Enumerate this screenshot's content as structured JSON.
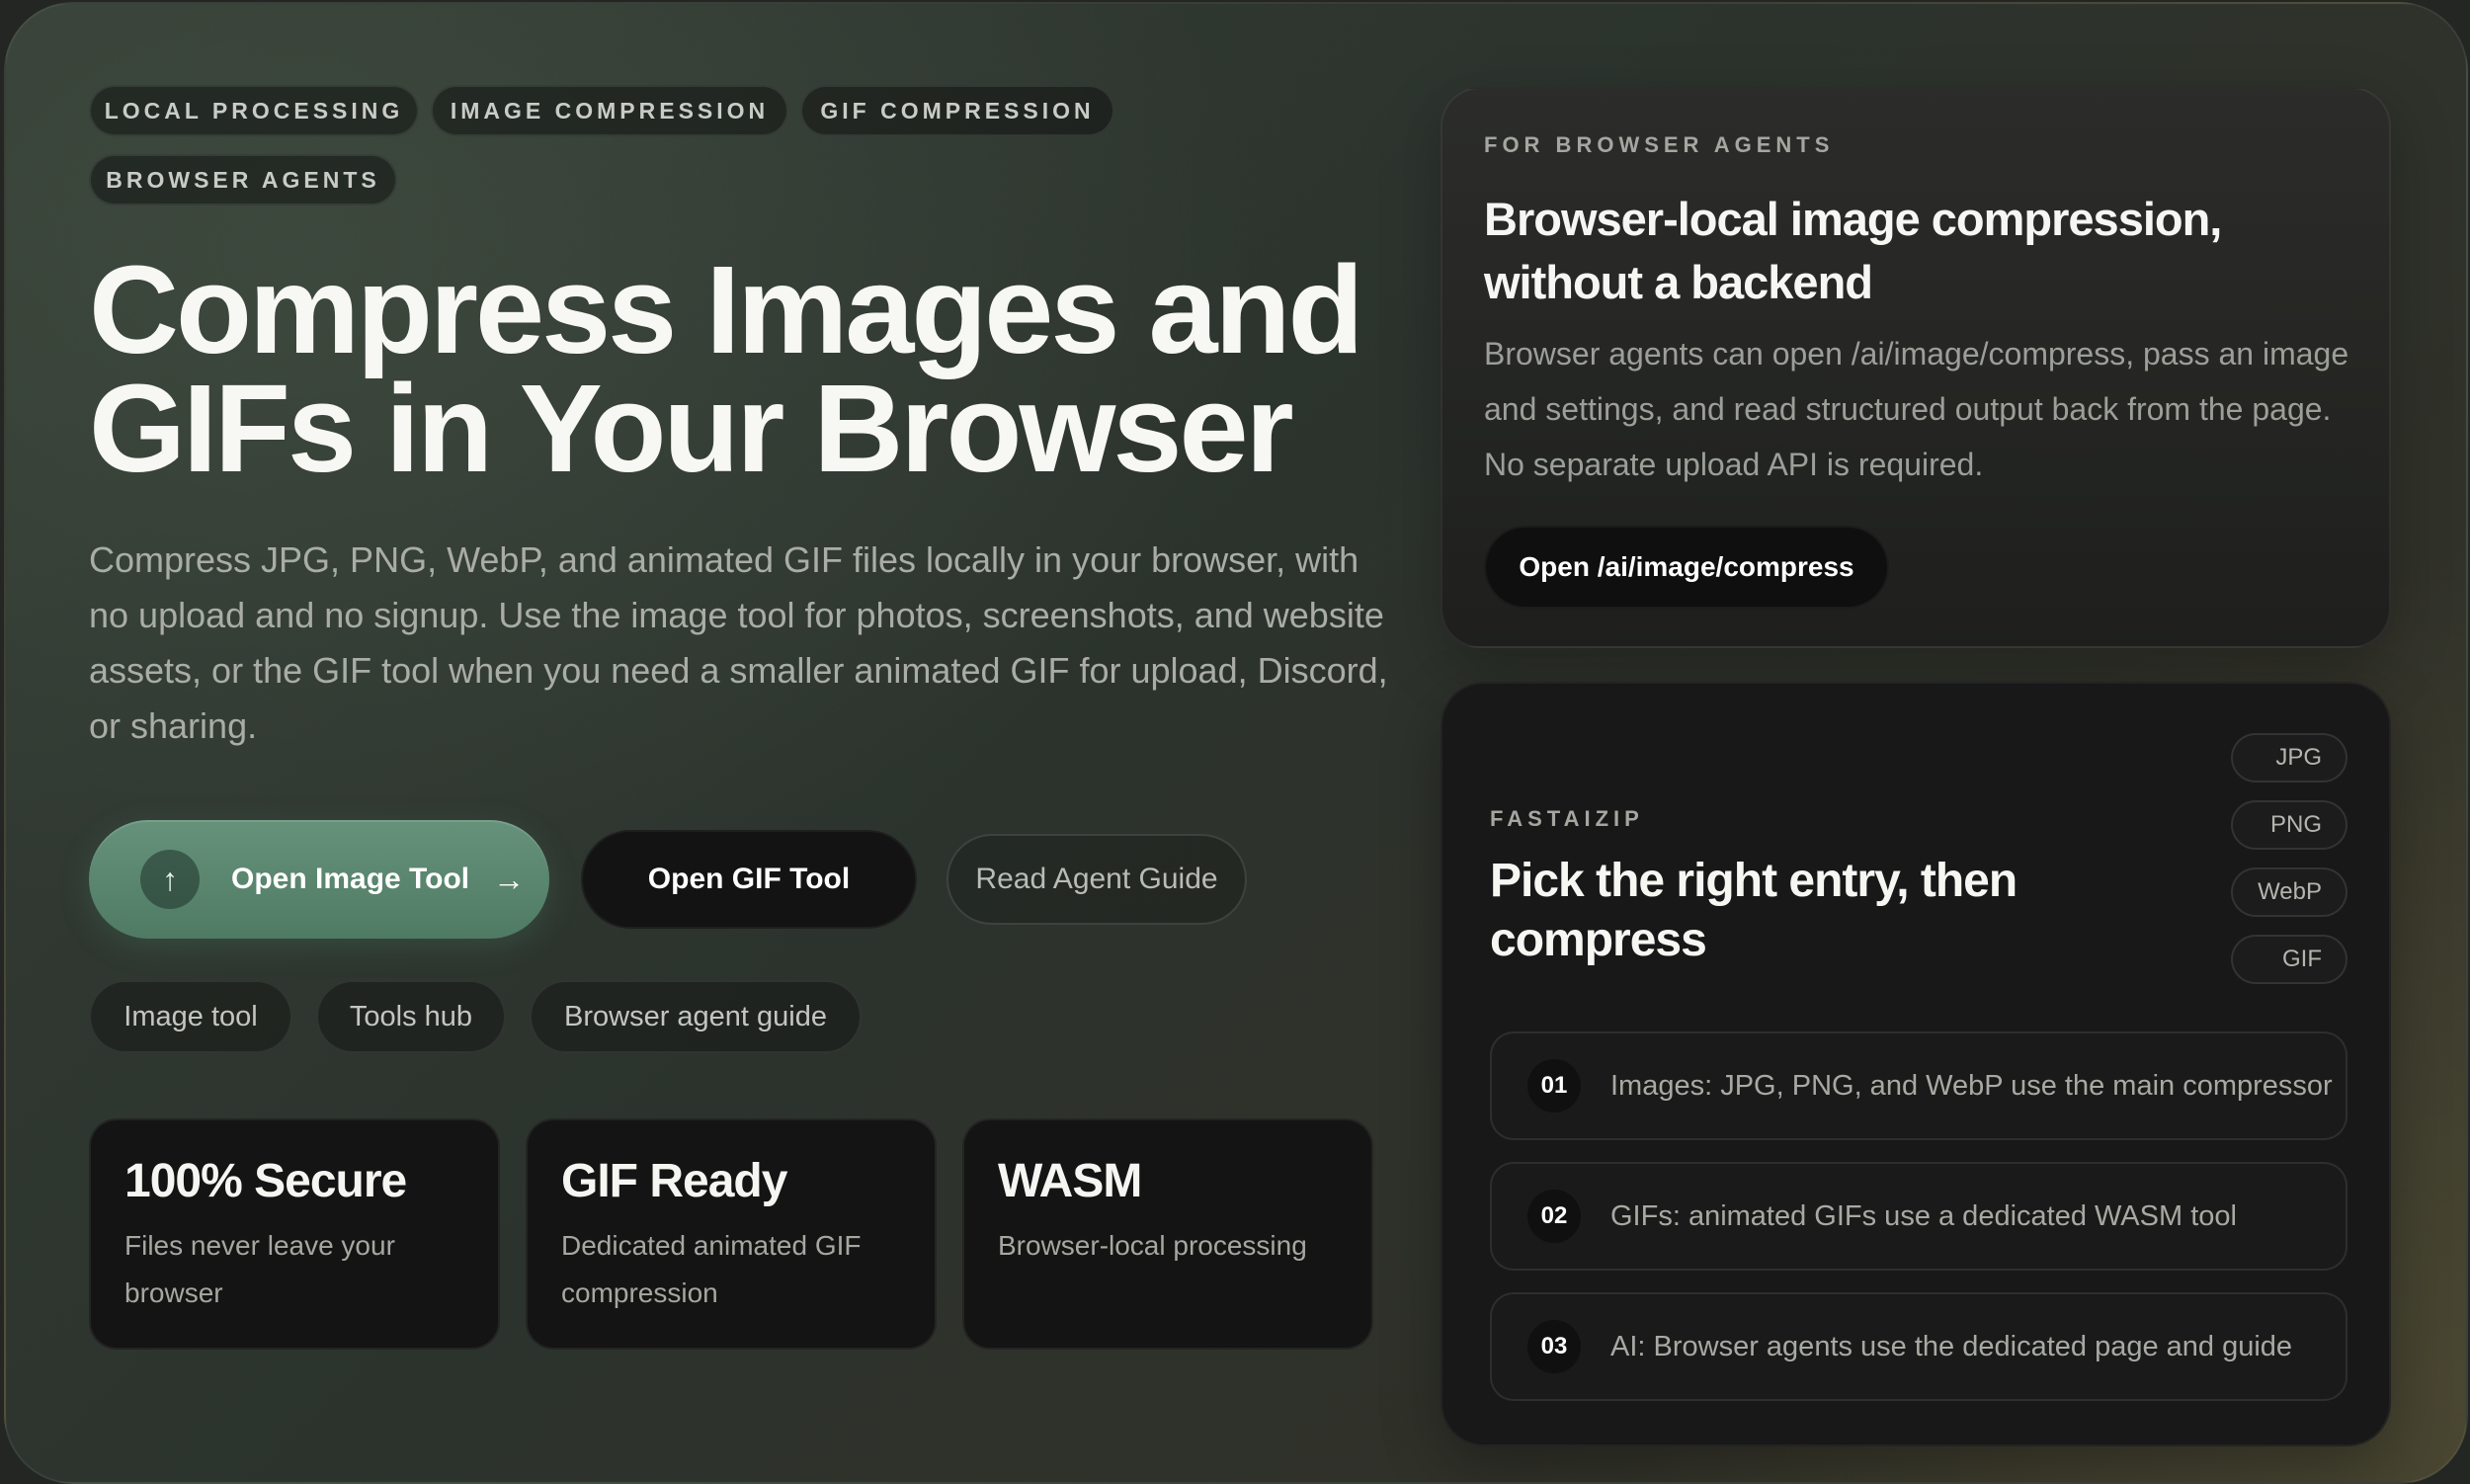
{
  "tags": [
    "LOCAL PROCESSING",
    "IMAGE COMPRESSION",
    "GIF COMPRESSION",
    "BROWSER AGENTS"
  ],
  "hero": {
    "title_line1": "Compress Images and",
    "title_line2": "GIFs in Your Browser",
    "subtitle": "Compress JPG, PNG, WebP, and animated GIF files locally in your browser, with no upload and no signup. Use the image tool for photos, screenshots, and website assets, or the GIF tool when you need a smaller animated GIF for upload, Discord, or sharing."
  },
  "actions": {
    "primary_label": "Open Image Tool",
    "primary_icon": "upload-arrow-icon",
    "primary_trailing_icon": "arrow-right-icon",
    "gif_label": "Open GIF Tool",
    "guide_label": "Read Agent Guide"
  },
  "links": [
    "Image tool",
    "Tools hub",
    "Browser agent guide"
  ],
  "stats": [
    {
      "title": "100% Secure",
      "text": "Files never leave your browser"
    },
    {
      "title": "GIF Ready",
      "text": "Dedicated animated GIF compression"
    },
    {
      "title": "WASM",
      "text": "Browser-local processing"
    }
  ],
  "agent_card": {
    "eyebrow": "FOR BROWSER AGENTS",
    "title": "Browser-local image compression, without a backend",
    "description": "Browser agents can open /ai/image/compress, pass an image and settings, and read structured output back from the page. No separate upload API is required.",
    "button_label": "Open /ai/image/compress"
  },
  "entry_card": {
    "eyebrow": "FASTAIZIP",
    "title": "Pick the right entry, then compress",
    "formats": [
      "JPG",
      "PNG",
      "WebP",
      "GIF"
    ],
    "steps": [
      {
        "num": "01",
        "text": "Images: JPG, PNG, and WebP use the main compressor"
      },
      {
        "num": "02",
        "text": "GIFs: animated GIFs use a dedicated WASM tool"
      },
      {
        "num": "03",
        "text": "AI: Browser agents use the dedicated page and guide"
      }
    ]
  },
  "colors": {
    "accent_green": "#5a866f",
    "card_dark": "#181818",
    "background": "#2f352f"
  }
}
